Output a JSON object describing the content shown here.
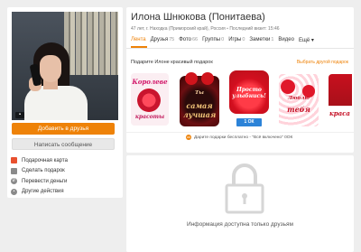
{
  "profile": {
    "name": "Илона Шнюкова (Понитаева)",
    "info": "47 лет, г. Находка (Приморский край), Россия",
    "last_visit": "Последний визит: 15:46",
    "add_friend_label": "Добавить в друзья",
    "write_message_label": "Написать сообщение"
  },
  "tabs": [
    {
      "label": "Лента",
      "count": ""
    },
    {
      "label": "Друзья",
      "count": "75"
    },
    {
      "label": "Фото",
      "count": "66"
    },
    {
      "label": "Группы",
      "count": "0"
    },
    {
      "label": "Игры",
      "count": "0"
    },
    {
      "label": "Заметки",
      "count": "1"
    },
    {
      "label": "Видео",
      "count": ""
    },
    {
      "label": "Ещё",
      "count": ""
    }
  ],
  "actions": [
    {
      "label": "Подарочная карта",
      "icon": "gift-card-icon"
    },
    {
      "label": "Сделать подарок",
      "icon": "gift-icon"
    },
    {
      "label": "Перевести деньги",
      "icon": "money-transfer-icon"
    },
    {
      "label": "Другие действия",
      "icon": "more-icon"
    }
  ],
  "gifts": {
    "title": "Подарите Илоне красивый подарок",
    "link": "Выбрать другой подарок",
    "items": [
      {
        "line1": "Королеве",
        "line2": "красоты"
      },
      {
        "line1": "Ты",
        "line2": "самая лучшая"
      },
      {
        "line1": "Просто улыбнись!",
        "ok": "1 ОК"
      },
      {
        "line1": "Люблю",
        "line2": "тебя"
      },
      {
        "line1": "Для",
        "line2": "краса"
      }
    ],
    "promo": "Дарите подарки бесплатно - \"Всё включено\" 0ОК"
  },
  "locked": {
    "text": "Информация доступна только друзьям"
  },
  "colors": {
    "accent": "#ee8208",
    "page_bg": "#eeeeee"
  }
}
